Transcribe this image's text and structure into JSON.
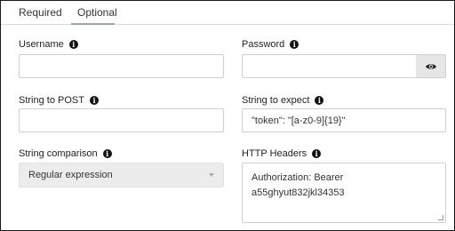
{
  "tabs": [
    {
      "label": "Required"
    },
    {
      "label": "Optional"
    }
  ],
  "username": {
    "label": "Username",
    "value": ""
  },
  "password": {
    "label": "Password",
    "value": ""
  },
  "string_to_post": {
    "label": "String to POST",
    "value": ""
  },
  "string_to_expect": {
    "label": "String to expect",
    "value": "\"token\": \"[a-z0-9]{19}\""
  },
  "string_comparison": {
    "label": "String comparison",
    "selected": "Regular expression"
  },
  "http_headers": {
    "label": "HTTP Headers",
    "line1": "Authorization: Bearer",
    "line2": "a55ghyut832jkl34353"
  },
  "icons": {
    "info": "info-icon",
    "eye": "eye-icon",
    "caret": "chevron-down-icon"
  }
}
